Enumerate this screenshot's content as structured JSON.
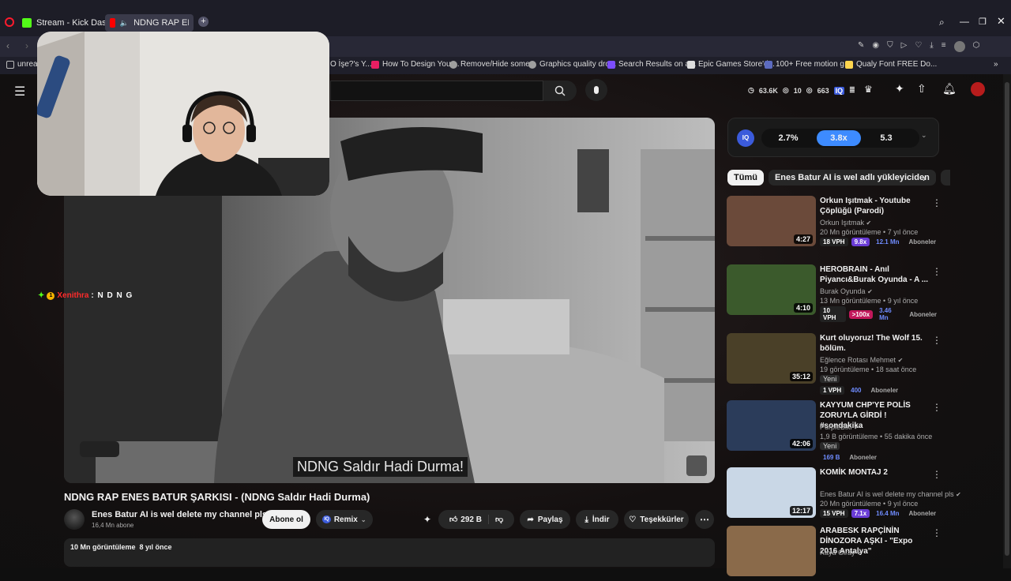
{
  "browser": {
    "tabs": [
      {
        "label": "Stream - Kick Dashboard",
        "color": "#53fc18"
      },
      {
        "label": "NDNG RAP ENES BATU",
        "color": "#ff0000"
      }
    ],
    "new_tab": "+",
    "bookmarks": [
      {
        "label": "unreal",
        "color": "#888888"
      },
      {
        "label": "O İşe?'s Y...",
        "color": "#cccccc"
      },
      {
        "label": "How To Design Your...",
        "color": "#e91e63"
      },
      {
        "label": "Remove/Hide some...",
        "color": "#9e9e9e"
      },
      {
        "label": "Graphics quality dro...",
        "color": "#9e9e9e"
      },
      {
        "label": "Search Results on a...",
        "color": "#7c4dff"
      },
      {
        "label": "Epic Games Store'd...",
        "color": "#dddddd"
      },
      {
        "label": "100+ Free motion g...",
        "color": "#5c6bc0"
      },
      {
        "label": "Qualy Font FREE Do...",
        "color": "#ffd54f"
      }
    ]
  },
  "header": {
    "stats": {
      "views": "63.6K",
      "a": "10",
      "b": "663"
    },
    "menu_icon": "hamburger-icon"
  },
  "iq_panel": {
    "label": "IQ",
    "values": [
      "2.7%",
      "3.8x",
      "5.3"
    ]
  },
  "filters": {
    "chips": [
      "Tümü",
      "Enes Batur AI is wel adlı yükleyiciden"
    ]
  },
  "video": {
    "subtitle": "NDNG Saldır Hadi Durma!",
    "title": "NDNG RAP ENES BATUR ŞARKISI - (NDNG Saldır Hadi Durma)",
    "channel": "Enes Batur AI is wel delete my channel pls",
    "subscribers": "16,4 Mn abone",
    "subscribe_label": "Abone ol",
    "remix_label": "Remix",
    "likes": "292 B",
    "share_label": "Paylaş",
    "download_label": "İndir",
    "thanks_label": "Teşekkürler",
    "description_stats": "10 Mn görüntüleme  8 yıl önce"
  },
  "chat_overlay": {
    "badge": "1",
    "username": "Xenithra",
    "message": ": N D N G"
  },
  "suggestions": [
    {
      "title": "Orkun Işıtmak - Youtube Çöplüğü (Parodi)",
      "channel": "Orkun Işıtmak",
      "meta": "20 Mn görüntüleme • 7 yıl önce",
      "duration": "4:27",
      "badges": [
        {
          "text": "18 VPH",
          "bg": "#222222",
          "fg": "#ffffff"
        },
        {
          "text": "9.8x",
          "bg": "#6a3cd6",
          "fg": "#ffffff"
        },
        {
          "text": "12.1 Mn",
          "bg": "transparent",
          "fg": "#6f8cff"
        },
        {
          "text": "Aboneler",
          "bg": "transparent",
          "fg": "#aaaaaa"
        }
      ],
      "thumb": "#6b4a3a"
    },
    {
      "title": "HEROBRAIN - Anıl Piyancı&Burak Oyunda - A ...",
      "channel": "Burak Oyunda",
      "meta": "13 Mn görüntüleme • 9 yıl önce",
      "duration": "4:10",
      "badges": [
        {
          "text": "10 VPH",
          "bg": "#222222",
          "fg": "#ffffff"
        },
        {
          "text": ">100x",
          "bg": "#c2185b",
          "fg": "#ffffff"
        },
        {
          "text": "3.46 Mn",
          "bg": "transparent",
          "fg": "#6f8cff"
        },
        {
          "text": "Aboneler",
          "bg": "transparent",
          "fg": "#aaaaaa"
        }
      ],
      "thumb": "#3b5a2c"
    },
    {
      "title": "Kurt oluyoruz! The Wolf 15. bölüm.",
      "channel": "Eğlence Rotası Mehmet",
      "meta": "19 görüntüleme • 18 saat önce",
      "tag": "Yeni",
      "duration": "35:12",
      "badges": [
        {
          "text": "1 VPH",
          "bg": "#222222",
          "fg": "#ffffff"
        },
        {
          "text": "400",
          "bg": "transparent",
          "fg": "#6f8cff"
        },
        {
          "text": "Aboneler",
          "bg": "transparent",
          "fg": "#aaaaaa"
        }
      ],
      "thumb": "#4a4028"
    },
    {
      "title": "KAYYUM CHP'YE POLİS ZORUYLA GİRDİ ! #sondakika",
      "channel": "PurpleBixi",
      "meta": "1,9 B görüntüleme • 55 dakika önce",
      "tag": "Yeni",
      "duration": "42:06",
      "badges": [
        {
          "text": "169 B",
          "bg": "transparent",
          "fg": "#6f8cff"
        },
        {
          "text": "Aboneler",
          "bg": "transparent",
          "fg": "#aaaaaa"
        }
      ],
      "thumb": "#2b3c5a"
    },
    {
      "title": "KOMİK MONTAJ 2",
      "channel": "Enes Batur AI is wel delete my channel pls",
      "meta": "20 Mn görüntüleme • 9 yıl önce",
      "duration": "12:17",
      "badges": [
        {
          "text": "15 VPH",
          "bg": "#222222",
          "fg": "#ffffff"
        },
        {
          "text": "7.1x",
          "bg": "#6a3cd6",
          "fg": "#ffffff"
        },
        {
          "text": "16.4 Mn",
          "bg": "transparent",
          "fg": "#6f8cff"
        },
        {
          "text": "Aboneler",
          "bg": "transparent",
          "fg": "#aaaaaa"
        }
      ],
      "thumb": "#c9d7e6"
    },
    {
      "title": "ARABESK RAPÇİNİN DİNOZORA AŞKI - \"Expo 2016 Antalya\"",
      "channel": "Kaya Giray",
      "meta": "",
      "duration": "",
      "badges": [],
      "thumb": "#8a6a4a"
    }
  ]
}
